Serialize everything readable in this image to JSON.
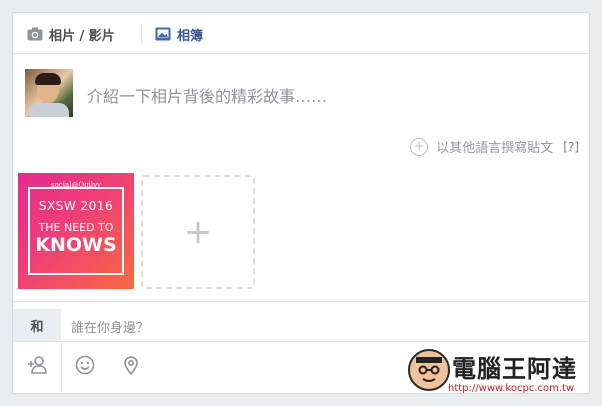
{
  "tabs": {
    "photo_video": "相片 / 影片",
    "album": "相簿"
  },
  "composer": {
    "placeholder": "介紹一下相片背後的精彩故事……"
  },
  "language": {
    "label": "以其他語言撰寫貼文",
    "help": "[?]"
  },
  "attachment": {
    "line1": "social@Ogilvy",
    "line2": "SXSW 2016",
    "line3": "THE NEED TO",
    "line4": "KNOWS"
  },
  "add_photo": {
    "symbol": "+"
  },
  "tag": {
    "label": "和",
    "placeholder": "誰在你身邊？"
  },
  "actions": [
    {
      "icon": "tag-friends-icon"
    },
    {
      "icon": "feeling-icon"
    },
    {
      "icon": "location-icon"
    }
  ],
  "watermark": {
    "title": "電腦王阿達",
    "url": "http://www.kocpc.com.tw"
  },
  "colors": {
    "link_blue": "#365899",
    "thumb_gradient_start": "#e42a8f",
    "thumb_gradient_end": "#f86a3f"
  }
}
